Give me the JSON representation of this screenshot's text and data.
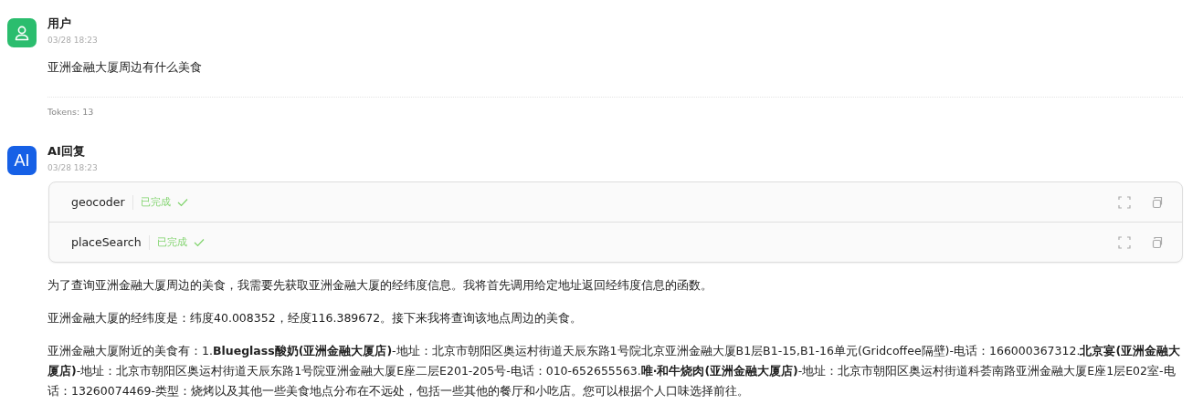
{
  "messages": [
    {
      "kind": "user",
      "name": "用户",
      "time": "03/28 18:23",
      "paragraphs": [
        "亚洲金融大厦周边有什么美食"
      ],
      "tokens": "Tokens: 13"
    },
    {
      "kind": "ai",
      "name": "AI回复",
      "avatar_text": "AI",
      "time": "03/28 18:23",
      "tools": [
        {
          "name": "geocoder",
          "status": "已完成",
          "done": true
        },
        {
          "name": "placeSearch",
          "status": "已完成",
          "done": true
        }
      ],
      "paragraphs": [
        "为了查询亚洲金融大厦周边的美食，我需要先获取亚洲金融大厦的经纬度信息。我将首先调用给定地址返回经纬度信息的函数。",
        "亚洲金融大厦的经纬度是：纬度40.008352，经度116.389672。接下来我将查询该地点周边的美食。",
        "亚洲金融大厦附近的美食有：1.**Blueglass酸奶(亚洲金融大厦店)**-地址：北京市朝阳区奥运村街道天辰东路1号院北京亚洲金融大厦B1层B1-15,B1-16单元(Gridcoffee隔壁)-电话：166000367312.**北京宴(亚洲金融大厦店)**-地址：北京市朝阳区奥运村街道天辰东路1号院亚洲金融大厦E座二层E201-205号-电话：010-652655563.**唯·和牛烧肉(亚洲金融大厦店)**-地址：北京市朝阳区奥运村街道科荟南路亚洲金融大厦E座1层E02室-电话：13260074469-类型：烧烤以及其他一些美食地点分布在不远处，包括一些其他的餐厅和小吃店。您可以根据个人口味选择前往。"
      ]
    }
  ]
}
